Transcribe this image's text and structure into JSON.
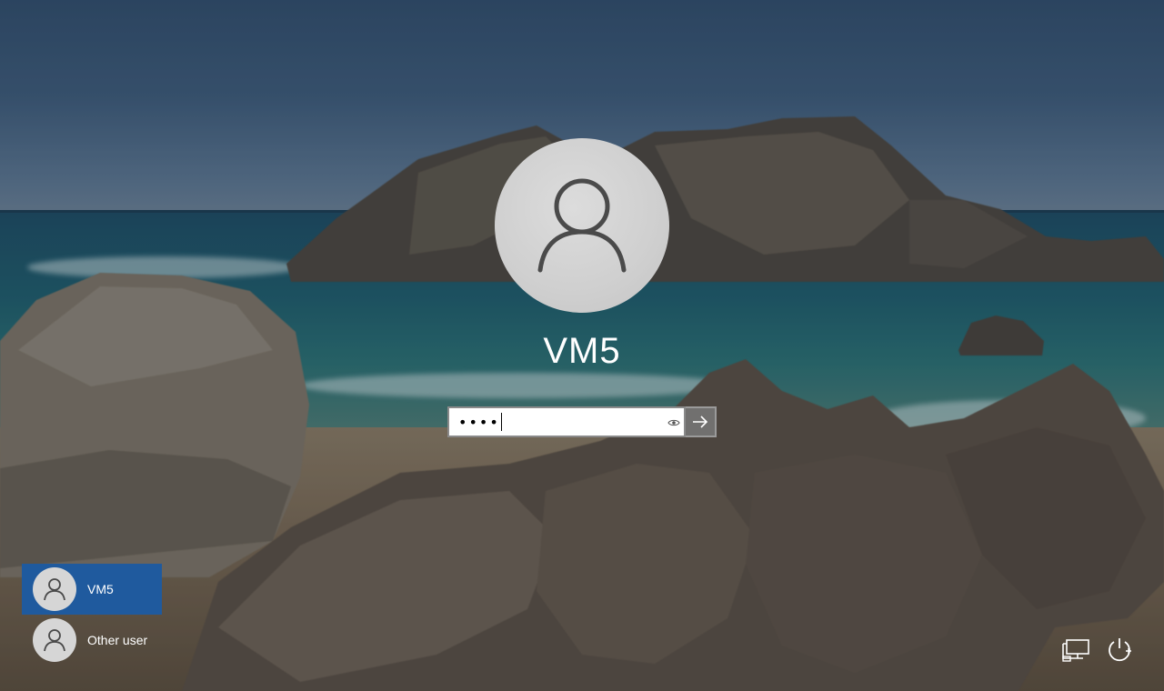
{
  "login": {
    "user_name": "VM5",
    "password_masked": "••••",
    "reveal_icon": "eye-icon",
    "submit_icon": "arrow-right-icon"
  },
  "user_list": [
    {
      "label": "VM5",
      "selected": true,
      "icon": "user-icon"
    },
    {
      "label": "Other user",
      "selected": false,
      "icon": "user-icon"
    }
  ],
  "corner_icons": [
    {
      "name": "network-icon"
    },
    {
      "name": "power-icon"
    }
  ],
  "colors": {
    "selected_user": "#1f5a9e",
    "avatar_bg": "#d6d6d6",
    "icon_stroke": "#4a4a4a"
  }
}
